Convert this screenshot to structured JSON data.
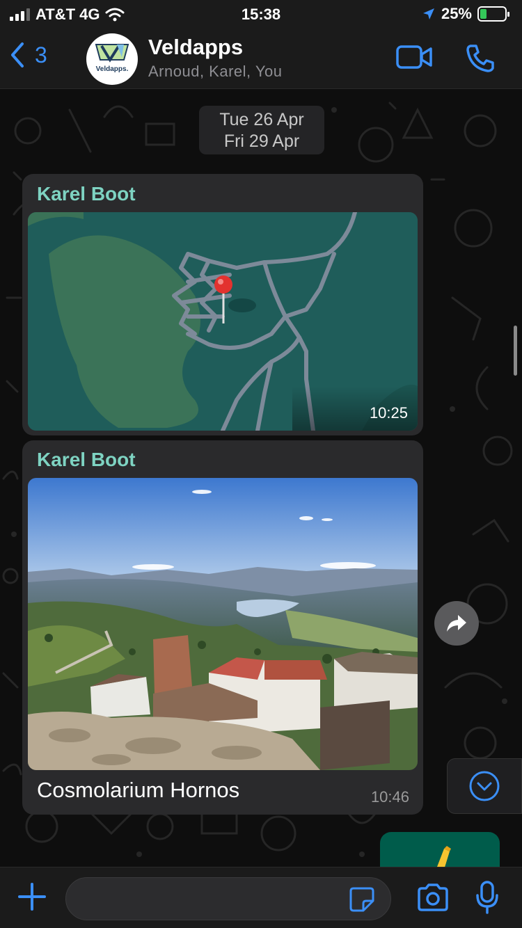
{
  "status_bar": {
    "carrier": "AT&T 4G",
    "time": "15:38",
    "battery": "25%",
    "battery_level": 0.25
  },
  "header": {
    "back_count": "3",
    "group_name": "Veldapps",
    "members": "Arnoud, Karel, You",
    "avatar_text": "Veldapps."
  },
  "date_pill": {
    "line1": "Tue 26 Apr",
    "line2": "Fri 29 Apr"
  },
  "messages": [
    {
      "type": "location",
      "sender": "Karel Boot",
      "time": "10:25"
    },
    {
      "type": "image",
      "sender": "Karel Boot",
      "caption": "Cosmolarium Hornos",
      "time": "10:46"
    }
  ],
  "composer": {
    "input_value": "",
    "placeholder": ""
  },
  "colors": {
    "accent": "#3b8ff7",
    "sender_name": "#7ed3c2",
    "bubble": "#2a2a2c",
    "outgoing": "#005c4b"
  }
}
